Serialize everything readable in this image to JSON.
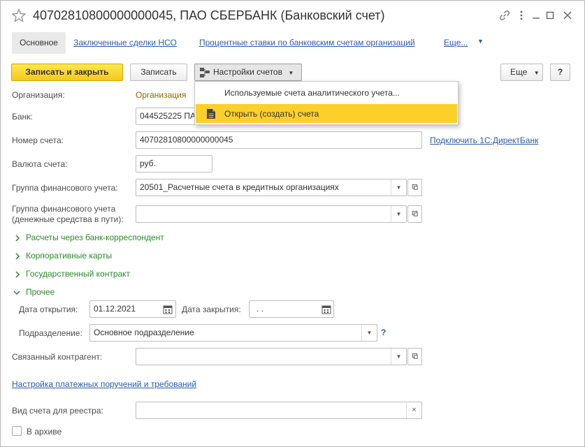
{
  "window": {
    "title": "40702810800000000045, ПАО СБЕРБАНК (Банковский счет)"
  },
  "tabs": [
    {
      "label": "Основное"
    },
    {
      "label": "Заключенные сделки НСО"
    },
    {
      "label": "Процентные ставки по банковским счетам организаций"
    },
    {
      "label": "Еще..."
    }
  ],
  "toolbar": {
    "save_close": "Записать и закрыть",
    "save": "Записать",
    "accounts_settings": "Настройки счетов",
    "more": "Еще",
    "help": "?"
  },
  "popup": {
    "items": [
      {
        "label": "Используемые счета аналитического учета..."
      },
      {
        "label": "Открыть (создать) счета"
      }
    ]
  },
  "form": {
    "organization": {
      "label": "Организация:",
      "value": "Организация"
    },
    "bank": {
      "label": "Банк:",
      "value": "044525225 ПАО"
    },
    "account_number": {
      "label": "Номер счета:",
      "value": "40702810800000000045"
    },
    "connect_link": "Подключить 1С:ДиректБанк",
    "currency": {
      "label": "Валюта счета:",
      "value": "руб."
    },
    "fin_group": {
      "label": "Группа финансового учета:",
      "value": "20501_Расчетные счета в кредитных организациях"
    },
    "fin_group_transit": {
      "label_line1": "Группа финансового учета",
      "label_line2": "(денежные средства в пути):",
      "value": ""
    },
    "groups": [
      {
        "label": "Расчеты через банк-корреспондент"
      },
      {
        "label": "Корпоративные карты"
      },
      {
        "label": "Государственный контракт"
      },
      {
        "label": "Прочее"
      }
    ],
    "open_date": {
      "label": "Дата открытия:",
      "value": "01.12.2021"
    },
    "close_date": {
      "label": "Дата закрытия:",
      "value": " .  ."
    },
    "department": {
      "label": "Подразделение:",
      "value": "Основное подразделение",
      "help": "?"
    },
    "counterparty": {
      "label": "Связанный контрагент:",
      "value": ""
    },
    "payment_settings_link": "Настройка платежных поручений и требований",
    "registry_type": {
      "label": "Вид счета для реестра:",
      "value": ""
    },
    "archive": {
      "label": "В архиве"
    }
  },
  "colors": {
    "primary_button": "#f5c91a",
    "link": "#2a5caa",
    "group_header": "#2a8a2a",
    "popup_highlight": "#fbd02a"
  }
}
